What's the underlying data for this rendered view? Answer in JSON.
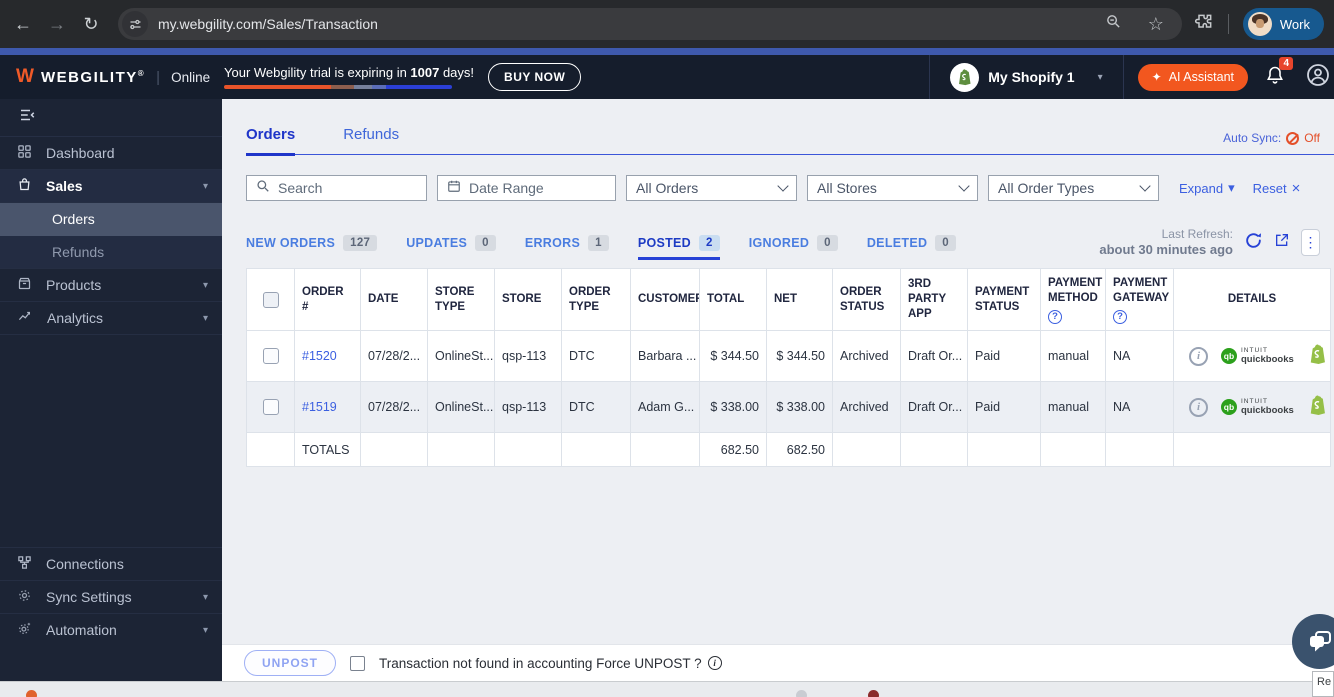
{
  "browser": {
    "url": "my.webgility.com/Sales/Transaction",
    "profile": "Work"
  },
  "icons": {
    "back": "←",
    "forward": "→",
    "reload": "↻",
    "star": "☆",
    "caret_down": "▾",
    "kebab": "⋮",
    "close": "×",
    "sparkle": "✦",
    "info_i": "i",
    "question": "?"
  },
  "header": {
    "logo_text": "WEBGILITY",
    "logo_reg": "®",
    "divider": "|",
    "mode": "Online",
    "trial_prefix": "Your Webgility trial is expiring in ",
    "trial_days": "1007",
    "trial_suffix": " days!",
    "buy_now": "BUY NOW",
    "store_selector": "My Shopify 1",
    "ai_assistant": "AI Assistant",
    "notification_count": "4"
  },
  "sidebar": {
    "items": [
      {
        "label": "Dashboard"
      },
      {
        "label": "Sales"
      },
      {
        "label": "Orders"
      },
      {
        "label": "Refunds"
      },
      {
        "label": "Products"
      },
      {
        "label": "Analytics"
      },
      {
        "label": "Connections"
      },
      {
        "label": "Sync Settings"
      },
      {
        "label": "Automation"
      }
    ]
  },
  "main": {
    "tabs": [
      {
        "label": "Orders"
      },
      {
        "label": "Refunds"
      }
    ],
    "auto_sync": {
      "label": "Auto Sync:",
      "value": "Off"
    },
    "filters": {
      "search": "Search",
      "date_range": "Date Range",
      "orders": "All Orders",
      "stores": "All Stores",
      "order_types": "All Order Types",
      "expand": "Expand",
      "reset": "Reset"
    },
    "status_tabs": [
      {
        "label": "NEW ORDERS",
        "count": "127"
      },
      {
        "label": "UPDATES",
        "count": "0"
      },
      {
        "label": "ERRORS",
        "count": "1"
      },
      {
        "label": "POSTED",
        "count": "2"
      },
      {
        "label": "IGNORED",
        "count": "0"
      },
      {
        "label": "DELETED",
        "count": "0"
      }
    ],
    "last_refresh": {
      "label": "Last Refresh:",
      "value": "about 30 minutes ago"
    },
    "table": {
      "columns": [
        "ORDER #",
        "DATE",
        "STORE TYPE",
        "STORE",
        "ORDER TYPE",
        "CUSTOMER",
        "TOTAL",
        "NET",
        "ORDER STATUS",
        "3RD PARTY APP",
        "PAYMENT STATUS",
        "PAYMENT METHOD",
        "PAYMENT GATEWAY",
        "DETAILS"
      ],
      "rows": [
        {
          "order_no": "#1520",
          "date": "07/28/2...",
          "store_type": "OnlineSt...",
          "store": "qsp-113",
          "order_type": "DTC",
          "customer": "Barbara ...",
          "total": "$ 344.50",
          "net": "$ 344.50",
          "order_status": "Archived",
          "third_party_app": "Draft Or...",
          "payment_status": "Paid",
          "payment_method": "manual",
          "payment_gateway": "NA"
        },
        {
          "order_no": "#1519",
          "date": "07/28/2...",
          "store_type": "OnlineSt...",
          "store": "qsp-113",
          "order_type": "DTC",
          "customer": "Adam G...",
          "total": "$ 338.00",
          "net": "$ 338.00",
          "order_status": "Archived",
          "third_party_app": "Draft Or...",
          "payment_status": "Paid",
          "payment_method": "manual",
          "payment_gateway": "NA"
        }
      ],
      "totals": {
        "label": "TOTALS",
        "total": "682.50",
        "net": "682.50"
      },
      "quickbooks_logo": {
        "line1": "INTUIT",
        "line2": "quickbooks"
      }
    },
    "footer": {
      "unpost": "UNPOST",
      "force_label": "Transaction not found in accounting Force UNPOST ?"
    },
    "corner_label": "Re"
  },
  "colors": {
    "accent_orange": "#f2571f",
    "accent_blue": "#2742d6",
    "status_red": "#e4502a",
    "shopify_green": "#95bf47",
    "quickbooks_green": "#2ca01c",
    "work_blue": "#17598f"
  }
}
